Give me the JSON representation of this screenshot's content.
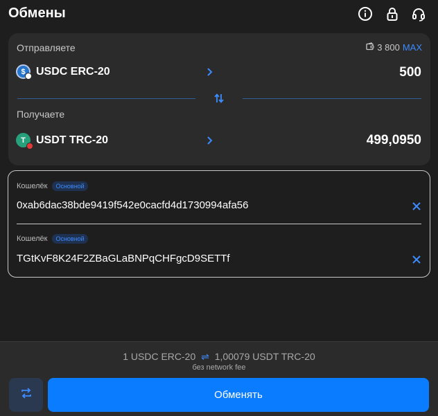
{
  "header": {
    "title": "Обмены",
    "icons": [
      "info-icon",
      "lock-icon",
      "support-headset-icon"
    ]
  },
  "send": {
    "label": "Отправляете",
    "balance": "3 800",
    "max_label": "MAX",
    "coin": "USDC ERC-20",
    "coin_icon": "usdc-icon",
    "amount": "500"
  },
  "receive": {
    "label": "Получаете",
    "coin": "USDT TRC-20",
    "coin_icon": "usdt-icon",
    "amount": "499,0950"
  },
  "wallets": [
    {
      "label": "Кошелёк",
      "tag": "Основной",
      "address": "0xab6dac38bde9419f542e0cacfd4d1730994afa56"
    },
    {
      "label": "Кошелёк",
      "tag": "Основной",
      "address": "TGtKvF8K24F2ZBaGLaBNPqCHFgcD9SETTf"
    }
  ],
  "footer": {
    "rate_from": "1 USDC ERC-20",
    "rate_to": "1,00079 USDT TRC-20",
    "fee_note": "без network fee",
    "exchange_label": "Обменять"
  },
  "colors": {
    "accent": "#0a7cff",
    "link": "#3d8bfd",
    "background": "#1e1e1e",
    "card": "#2b2b2b"
  }
}
